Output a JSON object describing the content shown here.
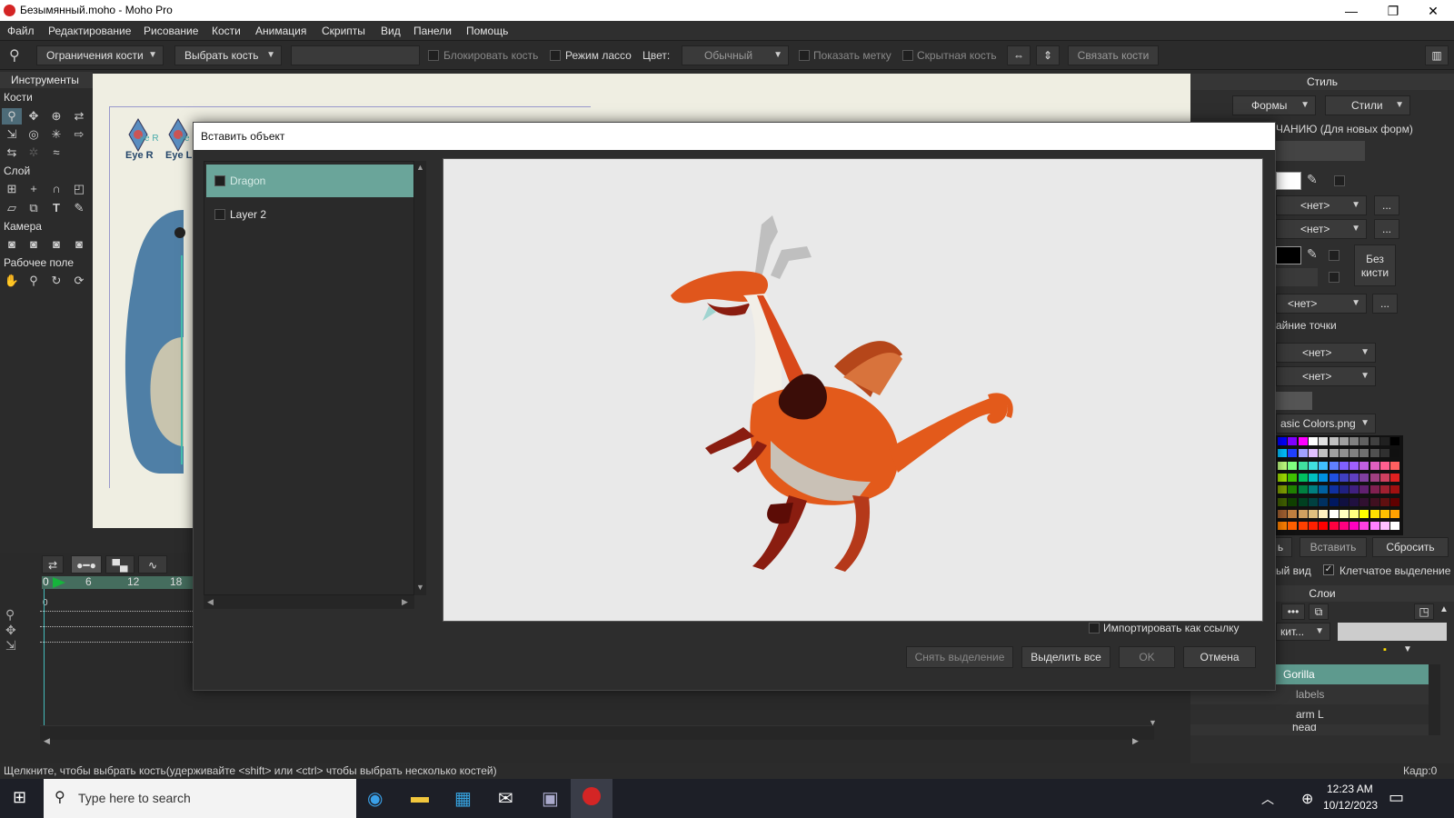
{
  "window": {
    "title": "Безымянный.moho - Moho Pro",
    "minimize": "—",
    "maximize": "❐",
    "close": "✕"
  },
  "menu": [
    "Файл",
    "Редактирование",
    "Рисование",
    "Кости",
    "Анимация",
    "Скрипты",
    "Вид",
    "Панели",
    "Помощь"
  ],
  "options": {
    "bone_constraints": "Ограничения кости",
    "select_bone": "Выбрать кость",
    "lock_bone": "Блокировать кость",
    "lasso_mode": "Режим лассо",
    "color_label": "Цвет:",
    "color_value": "Обычный",
    "show_label": "Показать метку",
    "hidden_bone": "Скрытная кость",
    "bind_bones": "Связать кости"
  },
  "tools": {
    "header": "Инструменты",
    "groups": [
      "Кости",
      "Слой",
      "Камера",
      "Рабочее поле"
    ]
  },
  "canvas": {
    "bone_labels": [
      "Eye R",
      "Eye L",
      "ye R",
      "ye"
    ]
  },
  "timeline": {
    "frame_start": "0",
    "ticks": [
      "6",
      "12",
      "18"
    ],
    "ruler_zero": "0"
  },
  "right_panel": {
    "style_header": "Стиль",
    "shapes_dd": "Формы",
    "styles_dd": "Стили",
    "defaults": "ЧАНИЮ (Для новых форм)",
    "none_values": [
      "<нет>",
      "<нет>",
      "<нет>",
      "<нет>",
      "<нет>"
    ],
    "no_brush": "Без кисти",
    "endpoints": "айние точки",
    "palette_file": "asic Colors.png",
    "copy_btn": "ь",
    "paste_btn": "Вставить",
    "reset_btn": "Сбросить",
    "view_label": "ый вид",
    "checker_label": "Клетчатое выделение",
    "layers_header": "Слои",
    "layer_filter": "кит...",
    "layers": [
      "Gorilla",
      "labels",
      "arm L",
      "head"
    ]
  },
  "dialog": {
    "title": "Вставить объект",
    "layers": [
      {
        "name": "Dragon",
        "selected": true
      },
      {
        "name": "Layer 2",
        "selected": false
      }
    ],
    "import_as_reference": "Импортировать как ссылку",
    "deselect_btn": "Снять выделение",
    "select_all_btn": "Выделить все",
    "ok_btn": "OK",
    "cancel_btn": "Отмена"
  },
  "status": {
    "hint": "Щелкните, чтобы выбрать кость(удерживайте <shift> или <ctrl> чтобы выбрать несколько костей)",
    "frame": "Кадр:0"
  },
  "taskbar": {
    "search_placeholder": "Type here to search",
    "time": "12:23 AM",
    "date": "10/12/2023"
  }
}
